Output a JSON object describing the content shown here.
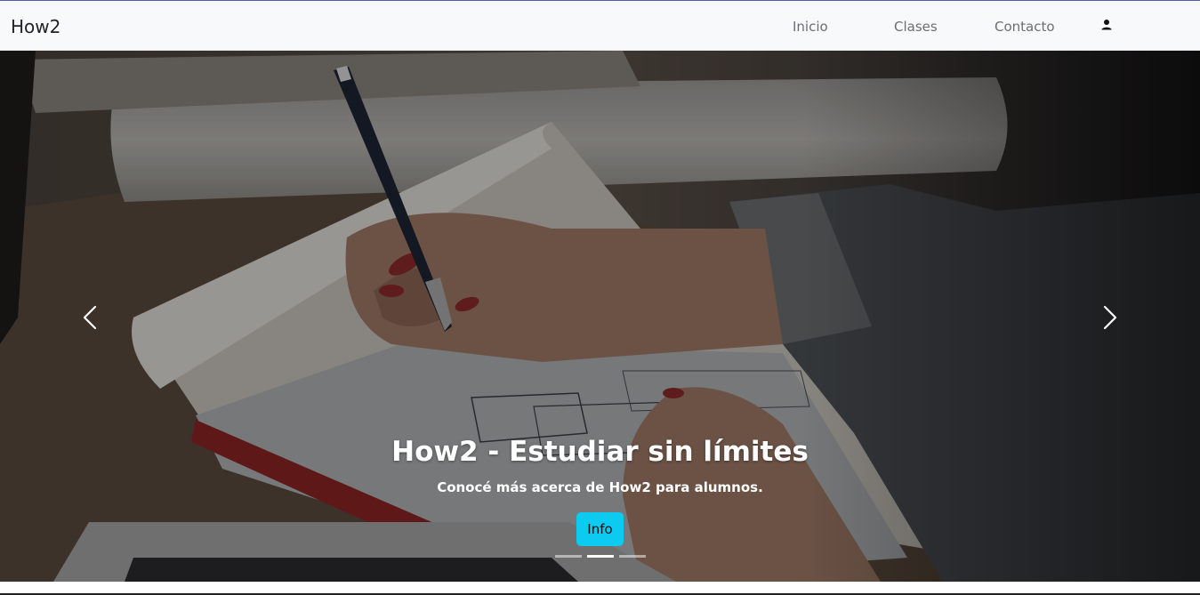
{
  "navbar": {
    "brand": "How2",
    "links": [
      "Inicio",
      "Clases",
      "Contacto"
    ],
    "user_icon": "person-icon"
  },
  "carousel": {
    "title": "How2 - Estudiar sin límites",
    "subtitle": "Conocé más acerca de How2 para alumnos.",
    "button_label": "Info",
    "prev_icon": "chevron-left-icon",
    "next_icon": "chevron-right-icon",
    "indicator_count": 3,
    "active_indicator": 2,
    "button_color": "#0dcaf0"
  }
}
